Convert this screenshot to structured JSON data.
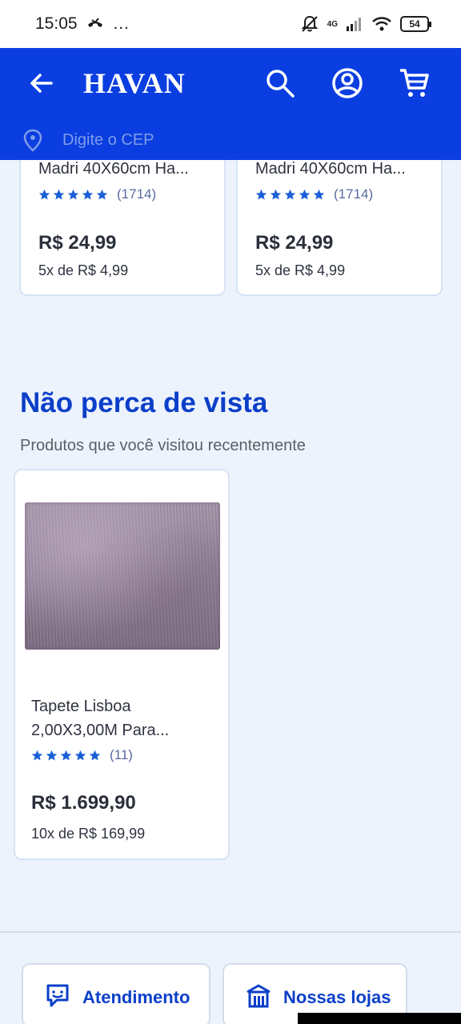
{
  "status_bar": {
    "time": "15:05",
    "notification_icons": "…",
    "network": "4G",
    "battery": "54"
  },
  "header": {
    "logo": "HAVAN",
    "cep_placeholder": "Digite o CEP",
    "brand_color": "#0a3ee0"
  },
  "top_products": [
    {
      "title": "Madri 40X60cm Ha...",
      "rating_count": "(1714)",
      "price": "R$ 24,99",
      "installments": "5x de R$ 4,99"
    },
    {
      "title": "Madri 40X60cm Ha...",
      "rating_count": "(1714)",
      "price": "R$ 24,99",
      "installments": "5x de R$ 4,99"
    }
  ],
  "recent_section": {
    "title": "Não perca de vista",
    "subtitle": "Produtos que você visitou recentemente",
    "product": {
      "title_line1": "Tapete Lisboa",
      "title_line2": "2,00X3,00M Para...",
      "rating_count": "(11)",
      "price": "R$ 1.699,90",
      "installments": "10x de R$ 169,99"
    }
  },
  "footer": {
    "support_label": "Atendimento",
    "stores_label": "Nossas lojas"
  }
}
